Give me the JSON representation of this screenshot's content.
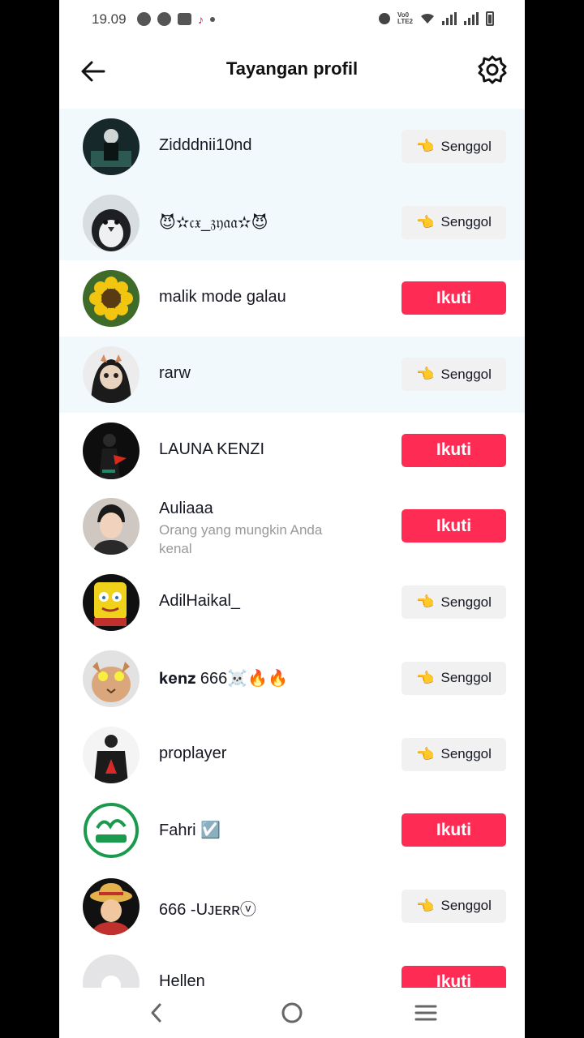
{
  "status_bar": {
    "time": "19.09",
    "notification_icons": [
      "messenger-icon",
      "messenger-icon",
      "gmail-icon",
      "tiktok-icon"
    ],
    "volte": "Vo0\nLTE2",
    "system_icons": [
      "dnd-icon",
      "volte-icon",
      "wifi-icon",
      "signal-icon",
      "signal-icon",
      "battery-icon"
    ]
  },
  "header": {
    "title": "Tayangan profil",
    "back_icon": "arrow-left-icon",
    "settings_icon": "gear-icon"
  },
  "colors": {
    "follow_button": "#fe2c55",
    "poke_button": "#f1f1f2",
    "highlight_row": "#f1f9fc"
  },
  "buttons": {
    "follow": "Ikuti",
    "poke": "Senggol",
    "poke_icon": "👈"
  },
  "viewers": [
    {
      "name": "Zidddnii10nd",
      "action": "poke",
      "highlight": true
    },
    {
      "name": "😈✫𝔠𝔵_𝔷𝔶𝔞𝔞✫😈",
      "action": "poke",
      "highlight": true
    },
    {
      "name": "malik mode galau",
      "action": "follow",
      "highlight": false
    },
    {
      "name": "rarw",
      "action": "poke",
      "highlight": true
    },
    {
      "name": "LAUNA KENZI",
      "action": "follow",
      "highlight": false
    },
    {
      "name": "Auliaaa",
      "subtitle": "Orang yang mungkin Anda kenal",
      "action": "follow",
      "highlight": false
    },
    {
      "name": "AdilHaikal_",
      "action": "poke",
      "highlight": false
    },
    {
      "name": "𝐤𝐞𝐧𝐳 666☠️🔥🔥",
      "action": "poke",
      "highlight": false
    },
    {
      "name": "proplayer",
      "action": "poke",
      "highlight": false
    },
    {
      "name": "Fahri ☑️",
      "action": "follow",
      "highlight": false
    },
    {
      "name": "666 -Uᴊᴇʀʀⓥ",
      "action": "poke",
      "highlight": false
    },
    {
      "name": "Hellen",
      "action": "follow",
      "highlight": false
    }
  ],
  "nav_bar": {
    "back_icon": "nav-back-icon",
    "home_icon": "nav-home-icon",
    "recents_icon": "nav-recents-icon"
  }
}
